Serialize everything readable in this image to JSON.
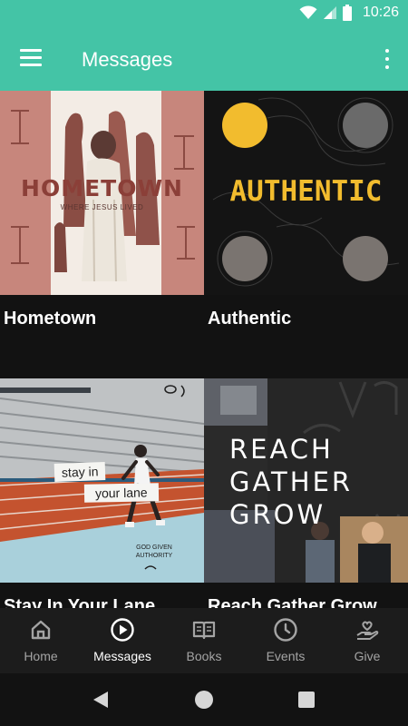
{
  "status_bar": {
    "time": "10:26",
    "icons": [
      "wifi-icon",
      "signal-icon",
      "battery-icon"
    ]
  },
  "app_bar": {
    "title": "Messages",
    "menu_icon": "menu-icon",
    "more_icon": "more-vert-icon"
  },
  "colors": {
    "accent": "#44c4a6",
    "background": "#121212",
    "nav_background": "#1c1c1c",
    "nav_inactive": "#a4a4a4",
    "nav_active": "#ffffff"
  },
  "series": [
    {
      "title": "Hometown",
      "art_heading": "HOMETOWN",
      "art_subheading": "WHERE JESUS LIVED"
    },
    {
      "title": "Authentic",
      "art_heading": "AUTHENTIC"
    },
    {
      "title": "Stay In Your Lane",
      "art_text_1": "stay in",
      "art_text_2": "your lane",
      "art_scribble": "GOD GIVEN AUTHORITY"
    },
    {
      "title": "Reach Gather Grow",
      "art_line_1": "REACH",
      "art_line_2": "GATHER",
      "art_line_3": "GROW"
    }
  ],
  "bottom_nav": {
    "active": "Messages",
    "items": [
      {
        "label": "Home",
        "icon": "home-icon"
      },
      {
        "label": "Messages",
        "icon": "play-circle-icon"
      },
      {
        "label": "Books",
        "icon": "book-icon"
      },
      {
        "label": "Events",
        "icon": "clock-icon"
      },
      {
        "label": "Give",
        "icon": "heart-hand-icon"
      }
    ]
  }
}
